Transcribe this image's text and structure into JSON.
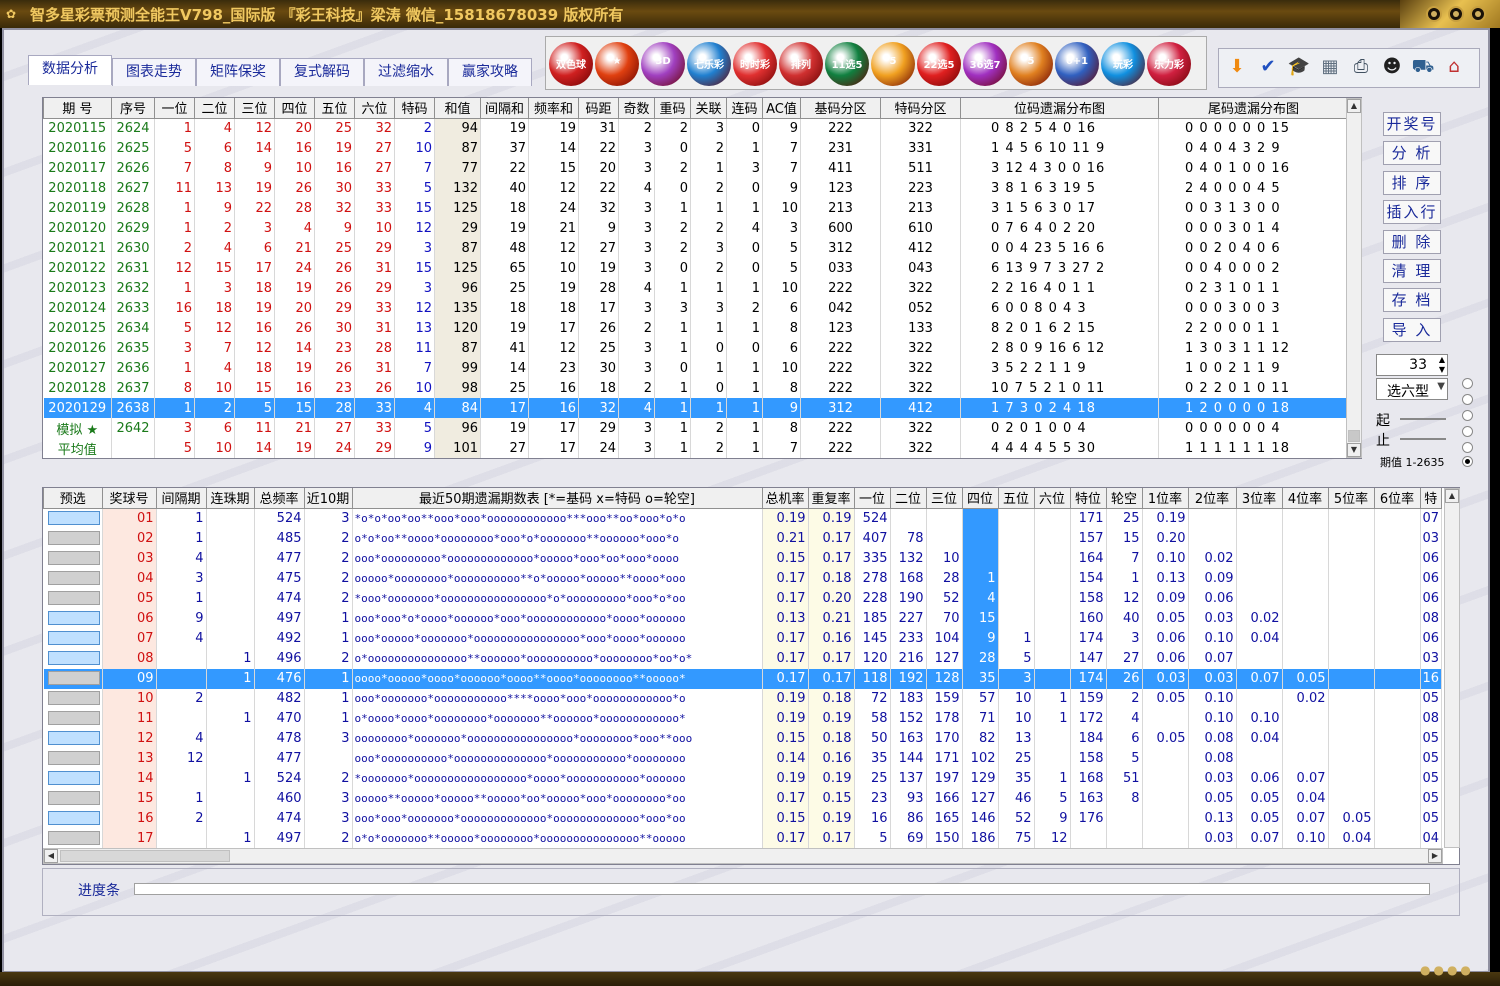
{
  "window": {
    "title": "智多星彩票预测全能王V798_国际版 『彩王科技』梁涛 微信_15818678039 版权所有"
  },
  "tabs": [
    "数据分析",
    "图表走势",
    "矩阵保奖",
    "复式解码",
    "过滤缩水",
    "赢家攻略"
  ],
  "lottery_logos": [
    {
      "label": "双色球",
      "color": "#d02020"
    },
    {
      "label": "★",
      "color": "#e04010"
    },
    {
      "label": "3D",
      "color": "#a040c0"
    },
    {
      "label": "七乐彩",
      "color": "#2080d0"
    },
    {
      "label": "时时彩",
      "color": "#e03030"
    },
    {
      "label": "排列",
      "color": "#d03030"
    },
    {
      "label": "11选5",
      "color": "#108040"
    },
    {
      "label": "5",
      "color": "#f0a020"
    },
    {
      "label": "22选5",
      "color": "#e02020"
    },
    {
      "label": "36选7",
      "color": "#a030c0"
    },
    {
      "label": "5",
      "color": "#e08020"
    },
    {
      "label": "6+1",
      "color": "#3060c0"
    },
    {
      "label": "玩彩",
      "color": "#1090e0"
    },
    {
      "label": "乐力彩",
      "color": "#d02040"
    }
  ],
  "toolbar_icons": [
    "arrow-down-icon",
    "spellcheck-icon",
    "graduation-icon",
    "calculator-icon",
    "printer-icon",
    "qq-icon",
    "basket-icon",
    "home-icon"
  ],
  "top_table": {
    "headers": [
      "期 号",
      "序号",
      "一位",
      "二位",
      "三位",
      "四位",
      "五位",
      "六位",
      "特码",
      "和值",
      "间隔和",
      "频率和",
      "码距",
      "奇数",
      "重码",
      "关联",
      "连码",
      "AC值",
      "基码分区",
      "特码分区",
      "位码遗漏分布图",
      "尾码遗漏分布图"
    ],
    "rows": [
      [
        "2020115",
        "2624",
        "1",
        "4",
        "12",
        "20",
        "25",
        "32",
        "2",
        "94",
        "19",
        "19",
        "31",
        "2",
        "2",
        "3",
        "0",
        "9",
        "222",
        "322",
        "0  8  2  5  4  0 16",
        "0  0  0  0  0  0 15"
      ],
      [
        "2020116",
        "2625",
        "5",
        "6",
        "14",
        "16",
        "19",
        "27",
        "10",
        "87",
        "37",
        "14",
        "22",
        "3",
        "0",
        "2",
        "1",
        "7",
        "231",
        "331",
        "1  4  5  6 10 11  9",
        "0  4  0  4  3  2  9"
      ],
      [
        "2020117",
        "2626",
        "7",
        "8",
        "9",
        "10",
        "16",
        "27",
        "7",
        "77",
        "22",
        "15",
        "20",
        "3",
        "2",
        "1",
        "3",
        "7",
        "411",
        "511",
        "3 12  4  3  0  0 16",
        "0  4  0  1  0  0 16"
      ],
      [
        "2020118",
        "2627",
        "11",
        "13",
        "19",
        "26",
        "30",
        "33",
        "5",
        "132",
        "40",
        "12",
        "22",
        "4",
        "0",
        "2",
        "0",
        "9",
        "123",
        "223",
        "3  8  1  6  3 19  5",
        "2  4  0  0  0  4  5"
      ],
      [
        "2020119",
        "2628",
        "1",
        "9",
        "22",
        "28",
        "32",
        "33",
        "15",
        "125",
        "18",
        "24",
        "32",
        "3",
        "1",
        "1",
        "1",
        "10",
        "213",
        "213",
        "3  1  5  6  3  0 17",
        "0  0  3  1  3  0  0"
      ],
      [
        "2020120",
        "2629",
        "1",
        "2",
        "3",
        "4",
        "9",
        "10",
        "12",
        "29",
        "19",
        "21",
        "9",
        "3",
        "2",
        "2",
        "4",
        "3",
        "600",
        "610",
        "0  7  6  4  0  2 20",
        "0  0  0  3  0  1  4"
      ],
      [
        "2020121",
        "2630",
        "2",
        "4",
        "6",
        "21",
        "25",
        "29",
        "3",
        "87",
        "48",
        "12",
        "27",
        "3",
        "2",
        "3",
        "0",
        "5",
        "312",
        "412",
        "0  0  4 23  5 16  6",
        "0  0  2  0  4  0  6"
      ],
      [
        "2020122",
        "2631",
        "12",
        "15",
        "17",
        "24",
        "26",
        "31",
        "15",
        "125",
        "65",
        "10",
        "19",
        "3",
        "0",
        "2",
        "0",
        "5",
        "033",
        "043",
        "6 13  9  7  3 27  2",
        "0  0  4  0  0  0  2"
      ],
      [
        "2020123",
        "2632",
        "1",
        "3",
        "18",
        "19",
        "26",
        "29",
        "3",
        "96",
        "25",
        "19",
        "28",
        "4",
        "1",
        "1",
        "1",
        "10",
        "222",
        "322",
        "2  2 16  4  0  1  1",
        "0  2  3  1  0  1  1"
      ],
      [
        "2020124",
        "2633",
        "16",
        "18",
        "19",
        "20",
        "29",
        "33",
        "12",
        "135",
        "18",
        "18",
        "17",
        "3",
        "3",
        "3",
        "2",
        "6",
        "042",
        "052",
        "6  0  0  8  0  4  3",
        "0  0  0  3  0  0  3"
      ],
      [
        "2020125",
        "2634",
        "5",
        "12",
        "16",
        "26",
        "30",
        "31",
        "13",
        "120",
        "19",
        "17",
        "26",
        "2",
        "1",
        "1",
        "1",
        "8",
        "123",
        "133",
        "8  2  0  1  6  2 15",
        "2  2  0  0  0  1  1"
      ],
      [
        "2020126",
        "2635",
        "3",
        "7",
        "12",
        "14",
        "23",
        "28",
        "11",
        "87",
        "41",
        "12",
        "25",
        "3",
        "1",
        "0",
        "0",
        "6",
        "222",
        "322",
        "2  8  0  9 16  6 12",
        "1  3  0  3  1  1 12"
      ],
      [
        "2020127",
        "2636",
        "1",
        "4",
        "18",
        "19",
        "26",
        "31",
        "7",
        "99",
        "14",
        "23",
        "30",
        "3",
        "0",
        "1",
        "1",
        "10",
        "222",
        "322",
        "3  5  2  2  1  1  9",
        "1  0  0  2  1  1  9"
      ],
      [
        "2020128",
        "2637",
        "8",
        "10",
        "15",
        "16",
        "23",
        "26",
        "10",
        "98",
        "25",
        "16",
        "18",
        "2",
        "1",
        "0",
        "1",
        "8",
        "222",
        "322",
        "10  7  5  2  1  0 11",
        "0  2  2  0  1  0 11"
      ],
      [
        "2020129",
        "2638",
        "1",
        "2",
        "5",
        "15",
        "28",
        "33",
        "4",
        "84",
        "17",
        "16",
        "32",
        "4",
        "1",
        "1",
        "1",
        "9",
        "312",
        "412",
        "1  7  3  0  2  4 18",
        "1  2  0  0  0  0 18"
      ],
      [
        "模拟 ★",
        "2642",
        "3",
        "6",
        "11",
        "21",
        "27",
        "33",
        "5",
        "96",
        "19",
        "17",
        "29",
        "3",
        "1",
        "2",
        "1",
        "8",
        "222",
        "322",
        "0  2  0  1  0  0  4",
        "0  0  0  0  0  0  4"
      ],
      [
        "平均值",
        "",
        "5",
        "10",
        "14",
        "19",
        "24",
        "29",
        "9",
        "101",
        "27",
        "17",
        "24",
        "3",
        "1",
        "2",
        "1",
        "7",
        "222",
        "322",
        "4  4  4  4  5  5 30",
        "1  1  1  1  1  1 18"
      ]
    ],
    "selected_row": 14
  },
  "right_buttons": [
    "开奖号",
    "分 析",
    "排 序",
    "插入行",
    "删 除",
    "清 理",
    "存 档",
    "导 入"
  ],
  "spinner_value": "33",
  "select_type": "选六型",
  "range_start_label": "起",
  "range_end_label": "止",
  "range_caption": "期值 1-2635",
  "bottom_table": {
    "headers": [
      "预选",
      "奖球号",
      "间隔期",
      "连珠期",
      "总频率",
      "近10期",
      "最近50期遗漏期数表 [*=基码 x=特码 o=轮空]",
      "总机率",
      "重复率",
      "一位",
      "二位",
      "三位",
      "四位",
      "五位",
      "六位",
      "特位",
      "轮空",
      "1位率",
      "2位率",
      "3位率",
      "4位率",
      "5位率",
      "6位率",
      "特"
    ],
    "rows": [
      {
        "pick": true,
        "c": [
          "01",
          "1",
          "",
          "524",
          "3",
          "*o*o*oo*oo**ooo*ooo*oooooooooooo***ooo**oo*ooo*o*o",
          "0.19",
          "0.19",
          "524",
          "",
          "",
          "",
          "",
          "",
          "171",
          "25",
          "0.19",
          "",
          "",
          "",
          "",
          "",
          "07"
        ]
      },
      {
        "pick": false,
        "c": [
          "02",
          "1",
          "",
          "485",
          "2",
          "o*o*oo**oooo*oooooooo*ooo*o*ooooooo**oooooo*ooo*o",
          "0.21",
          "0.17",
          "407",
          "78",
          "",
          "",
          "",
          "",
          "157",
          "15",
          "0.20",
          "",
          "",
          "",
          "",
          "",
          "03"
        ]
      },
      {
        "pick": false,
        "c": [
          "03",
          "4",
          "",
          "477",
          "2",
          "ooo*ooooooooo*ooooooooooooo*ooooo*ooo*oo*ooo*oooo",
          "0.15",
          "0.17",
          "335",
          "132",
          "10",
          "",
          "",
          "",
          "164",
          "7",
          "0.10",
          "0.02",
          "",
          "",
          "",
          "",
          "06"
        ]
      },
      {
        "pick": false,
        "c": [
          "04",
          "3",
          "",
          "475",
          "2",
          "ooooo*oooooooo*oooooooooo**o*ooooo*ooooo**oooo*ooo",
          "0.17",
          "0.18",
          "278",
          "168",
          "28",
          "1",
          "",
          "",
          "154",
          "1",
          "0.13",
          "0.09",
          "",
          "",
          "",
          "",
          "06"
        ]
      },
      {
        "pick": false,
        "c": [
          "05",
          "1",
          "",
          "474",
          "2",
          "*ooo*ooooooo*oooooooooooooooo*o*ooooooooo*ooo*o*oo",
          "0.17",
          "0.20",
          "228",
          "190",
          "52",
          "4",
          "",
          "",
          "158",
          "12",
          "0.09",
          "0.06",
          "",
          "",
          "",
          "",
          "06"
        ]
      },
      {
        "pick": true,
        "c": [
          "06",
          "9",
          "",
          "497",
          "1",
          "ooo*ooo*o*oooo*oooooo*ooo*oooooooooooo*oooo*oooooo",
          "0.13",
          "0.21",
          "185",
          "227",
          "70",
          "15",
          "",
          "",
          "160",
          "40",
          "0.05",
          "0.03",
          "0.02",
          "",
          "",
          "",
          "08"
        ]
      },
      {
        "pick": true,
        "c": [
          "07",
          "4",
          "",
          "492",
          "1",
          "ooo*ooooo*ooooooo*oooooooooooooooo*ooo*oooo*oooooo",
          "0.17",
          "0.16",
          "145",
          "233",
          "104",
          "9",
          "1",
          "",
          "174",
          "3",
          "0.06",
          "0.10",
          "0.04",
          "",
          "",
          "",
          "06"
        ]
      },
      {
        "pick": true,
        "c": [
          "08",
          "",
          "1",
          "496",
          "2",
          "o*ooooooooooooooo**oooooo*oooooooooo*oooooooo*oo*o*",
          "0.17",
          "0.17",
          "120",
          "216",
          "127",
          "28",
          "5",
          "",
          "147",
          "27",
          "0.06",
          "0.07",
          "",
          "",
          "",
          "",
          "03"
        ]
      },
      {
        "pick": false,
        "c": [
          "09",
          "",
          "1",
          "476",
          "1",
          "oooo*ooooo*oooo*oooooo*oooo**oooo*oooooooo**ooooo*",
          "0.17",
          "0.17",
          "118",
          "192",
          "128",
          "35",
          "3",
          "",
          "174",
          "26",
          "0.03",
          "0.03",
          "0.07",
          "0.05",
          "",
          "",
          "16"
        ]
      },
      {
        "pick": false,
        "c": [
          "10",
          "2",
          "",
          "482",
          "1",
          "ooo*ooooooo*ooooooooooo****oooo*ooo*oooooooooooo*o",
          "0.19",
          "0.18",
          "72",
          "183",
          "159",
          "57",
          "10",
          "1",
          "159",
          "2",
          "0.05",
          "0.10",
          "",
          "0.02",
          "",
          "",
          "05"
        ]
      },
      {
        "pick": false,
        "c": [
          "11",
          "",
          "1",
          "470",
          "1",
          "o*oooo*oooo*oooooooo*ooooooo**oooooo*oooooooooooo*",
          "0.19",
          "0.19",
          "58",
          "152",
          "178",
          "71",
          "10",
          "1",
          "172",
          "4",
          "",
          "0.10",
          "0.10",
          "",
          "",
          "",
          "08"
        ]
      },
      {
        "pick": true,
        "c": [
          "12",
          "4",
          "",
          "478",
          "3",
          "oooooooo*ooooooo*oooooooooooooooo*oooooooo*ooo**ooo",
          "0.15",
          "0.18",
          "50",
          "163",
          "170",
          "82",
          "13",
          "",
          "184",
          "6",
          "0.05",
          "0.08",
          "0.04",
          "",
          "",
          "",
          "05"
        ]
      },
      {
        "pick": false,
        "c": [
          "13",
          "12",
          "",
          "477",
          "",
          "ooo*oooooooooo*oooooooooooooo*ooooooooooo*oooooooo",
          "0.14",
          "0.16",
          "35",
          "144",
          "171",
          "102",
          "25",
          "",
          "158",
          "5",
          "",
          "0.08",
          "",
          "",
          "",
          "",
          "05"
        ]
      },
      {
        "pick": true,
        "c": [
          "14",
          "",
          "1",
          "524",
          "2",
          "*ooooooo*ooooooooooooooooo*oooo*ooooooooooo*oooooo",
          "0.19",
          "0.19",
          "25",
          "137",
          "197",
          "129",
          "35",
          "1",
          "168",
          "51",
          "",
          "0.03",
          "0.06",
          "0.07",
          "",
          "",
          "05"
        ]
      },
      {
        "pick": false,
        "c": [
          "15",
          "1",
          "",
          "460",
          "3",
          "ooooo**ooooo*ooooo**ooooo*oo*ooooo*ooo*oooooooo*oo",
          "0.17",
          "0.15",
          "23",
          "93",
          "166",
          "127",
          "46",
          "5",
          "163",
          "8",
          "",
          "0.05",
          "0.05",
          "0.04",
          "",
          "",
          "05"
        ]
      },
      {
        "pick": true,
        "c": [
          "16",
          "2",
          "",
          "474",
          "3",
          "ooo*ooo*ooooooo*ooooooooooooo*ooooooooooooo*ooo*oo",
          "0.15",
          "0.19",
          "16",
          "86",
          "165",
          "146",
          "52",
          "9",
          "176",
          "",
          "",
          "0.13",
          "0.05",
          "0.07",
          "0.05",
          "",
          "05"
        ]
      },
      {
        "pick": false,
        "c": [
          "17",
          "",
          "1",
          "497",
          "2",
          "o*o*ooooooo**ooooo*oooooooo*ooooooooooooooo**ooooo",
          "0.17",
          "0.17",
          "5",
          "69",
          "150",
          "186",
          "75",
          "12",
          "",
          "",
          "",
          "0.03",
          "0.07",
          "0.10",
          "0.04",
          "",
          "04"
        ]
      }
    ],
    "selected_row": 8
  },
  "progress_label": "进度条",
  "colors": {
    "selection": "#3399ff",
    "red": "#d01010",
    "blue": "#1010c0",
    "green": "#1a7a1a"
  }
}
